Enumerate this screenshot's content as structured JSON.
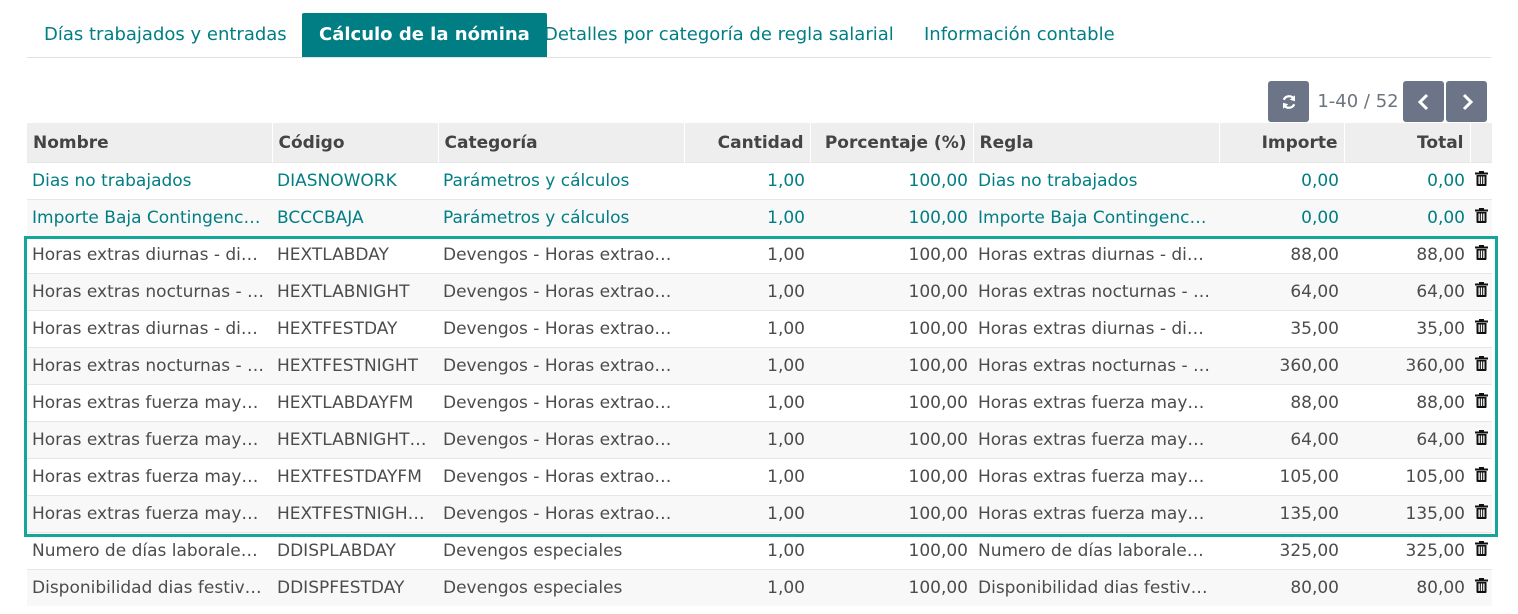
{
  "tabs": [
    {
      "label": "Días trabajados y entradas",
      "active": false
    },
    {
      "label": "Cálculo de la nómina",
      "active": true
    },
    {
      "label": "Detalles por categoría de regla salarial",
      "active": false
    },
    {
      "label": "Información contable",
      "active": false
    }
  ],
  "pager": {
    "text": "1-40 / 52"
  },
  "table": {
    "headers": {
      "nombre": "Nombre",
      "codigo": "Código",
      "categoria": "Categoría",
      "cantidad": "Cantidad",
      "porcentaje": "Porcentaje (%)",
      "regla": "Regla",
      "importe": "Importe",
      "total": "Total"
    },
    "rows": [
      {
        "nombre": "Dias no trabajados",
        "codigo": "DIASNOWORK",
        "categoria": "Parámetros y cálculos",
        "cantidad": "1,00",
        "porcentaje": "100,00",
        "regla": "Dias no trabajados",
        "importe": "0,00",
        "total": "0,00"
      },
      {
        "nombre": "Importe Baja Contingenc…",
        "codigo": "BCCCBAJA",
        "categoria": "Parámetros y cálculos",
        "cantidad": "1,00",
        "porcentaje": "100,00",
        "regla": "Importe Baja Contingenc…",
        "importe": "0,00",
        "total": "0,00"
      },
      {
        "nombre": "Horas extras diurnas - di…",
        "codigo": "HEXTLABDAY",
        "categoria": "Devengos - Horas extrao…",
        "cantidad": "1,00",
        "porcentaje": "100,00",
        "regla": "Horas extras diurnas - di…",
        "importe": "88,00",
        "total": "88,00"
      },
      {
        "nombre": "Horas extras nocturnas - …",
        "codigo": "HEXTLABNIGHT",
        "categoria": "Devengos - Horas extrao…",
        "cantidad": "1,00",
        "porcentaje": "100,00",
        "regla": "Horas extras nocturnas - …",
        "importe": "64,00",
        "total": "64,00"
      },
      {
        "nombre": "Horas extras diurnas - di…",
        "codigo": "HEXTFESTDAY",
        "categoria": "Devengos - Horas extrao…",
        "cantidad": "1,00",
        "porcentaje": "100,00",
        "regla": "Horas extras diurnas - di…",
        "importe": "35,00",
        "total": "35,00"
      },
      {
        "nombre": "Horas extras nocturnas - …",
        "codigo": "HEXTFESTNIGHT",
        "categoria": "Devengos - Horas extrao…",
        "cantidad": "1,00",
        "porcentaje": "100,00",
        "regla": "Horas extras nocturnas - …",
        "importe": "360,00",
        "total": "360,00"
      },
      {
        "nombre": "Horas extras fuerza may…",
        "codigo": "HEXTLABDAYFM",
        "categoria": "Devengos - Horas extrao…",
        "cantidad": "1,00",
        "porcentaje": "100,00",
        "regla": "Horas extras fuerza may…",
        "importe": "88,00",
        "total": "88,00"
      },
      {
        "nombre": "Horas extras fuerza may…",
        "codigo": "HEXTLABNIGHTFM",
        "categoria": "Devengos - Horas extrao…",
        "cantidad": "1,00",
        "porcentaje": "100,00",
        "regla": "Horas extras fuerza may…",
        "importe": "64,00",
        "total": "64,00"
      },
      {
        "nombre": "Horas extras fuerza may…",
        "codigo": "HEXTFESTDAYFM",
        "categoria": "Devengos - Horas extrao…",
        "cantidad": "1,00",
        "porcentaje": "100,00",
        "regla": "Horas extras fuerza may…",
        "importe": "105,00",
        "total": "105,00"
      },
      {
        "nombre": "Horas extras fuerza may…",
        "codigo": "HEXTFESTNIGHTF…",
        "categoria": "Devengos - Horas extrao…",
        "cantidad": "1,00",
        "porcentaje": "100,00",
        "regla": "Horas extras fuerza may…",
        "importe": "135,00",
        "total": "135,00"
      },
      {
        "nombre": "Numero de días laborale…",
        "codigo": "DDISPLABDAY",
        "categoria": "Devengos especiales",
        "cantidad": "1,00",
        "porcentaje": "100,00",
        "regla": "Numero de días laborale…",
        "importe": "325,00",
        "total": "325,00"
      },
      {
        "nombre": "Disponibilidad dias festiv…",
        "codigo": "DDISPFESTDAY",
        "categoria": "Devengos especiales",
        "cantidad": "1,00",
        "porcentaje": "100,00",
        "regla": "Disponibilidad dias festiv…",
        "importe": "80,00",
        "total": "80,00"
      }
    ]
  },
  "icons": {
    "refresh": "refresh-icon",
    "prev": "chevron-left-icon",
    "next": "chevron-right-icon",
    "delete": "trash-icon"
  },
  "colors": {
    "accent": "#017e84",
    "highlight": "#14a69a",
    "button": "#6c7587"
  }
}
